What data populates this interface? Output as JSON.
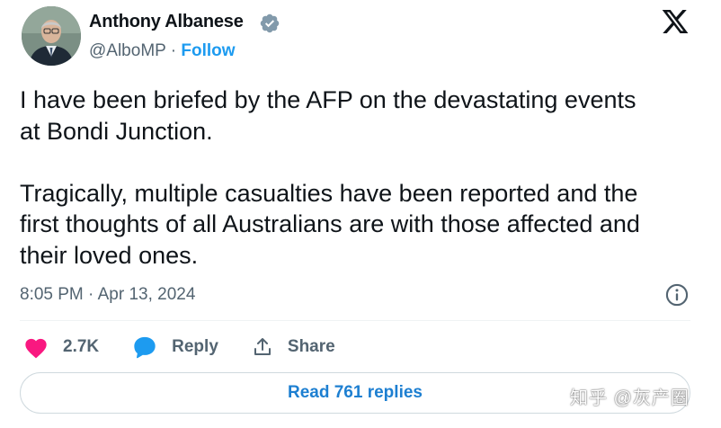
{
  "author": {
    "name": "Anthony Albanese",
    "handle": "@AlboMP",
    "separator": " · ",
    "follow_label": "Follow",
    "avatar_icon": "person-portrait"
  },
  "tweet": {
    "text": "I have been briefed by the AFP on the devastating events\nat Bondi Junction.\n\nTragically, multiple casualties have been reported and the\nfirst thoughts of all Australians are with those affected and\ntheir loved ones.",
    "timestamp": "8:05 PM · Apr 13, 2024"
  },
  "actions": {
    "like_count": "2.7K",
    "reply_label": "Reply",
    "share_label": "Share"
  },
  "read_replies_label": "Read 761 replies",
  "watermark": "知乎 @灰产圈",
  "colors": {
    "brand_blue": "#1d9bf0",
    "like_pink": "#f91880",
    "secondary_text": "#536471",
    "primary_text": "#0f1419",
    "border": "#cfd9de"
  },
  "icons": [
    "verified-badge-icon",
    "x-logo-icon",
    "info-icon",
    "heart-icon",
    "reply-bubble-icon",
    "share-icon"
  ]
}
